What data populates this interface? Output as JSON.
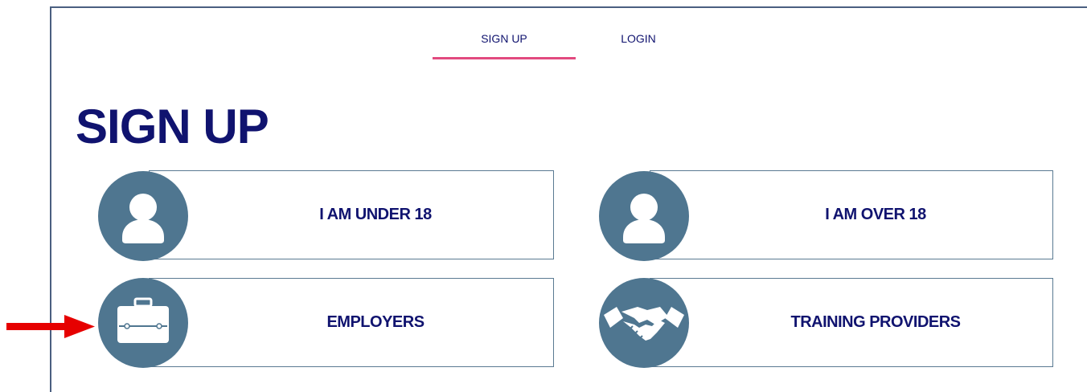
{
  "tabs": {
    "signup_label": "SIGN UP",
    "login_label": "LOGIN"
  },
  "page": {
    "title": "SIGN UP"
  },
  "cards": {
    "under18": {
      "label": "I AM UNDER 18",
      "icon": "person-icon"
    },
    "over18": {
      "label": "I AM OVER 18",
      "icon": "person-icon"
    },
    "employers": {
      "label": "EMPLOYERS",
      "icon": "briefcase-icon"
    },
    "training": {
      "label": "TRAINING PROVIDERS",
      "icon": "handshake-icon"
    }
  },
  "colors": {
    "brand_navy": "#10136f",
    "icon_circle": "#4f7690",
    "tab_underline": "#e24a7f",
    "arrow": "#e60000"
  }
}
